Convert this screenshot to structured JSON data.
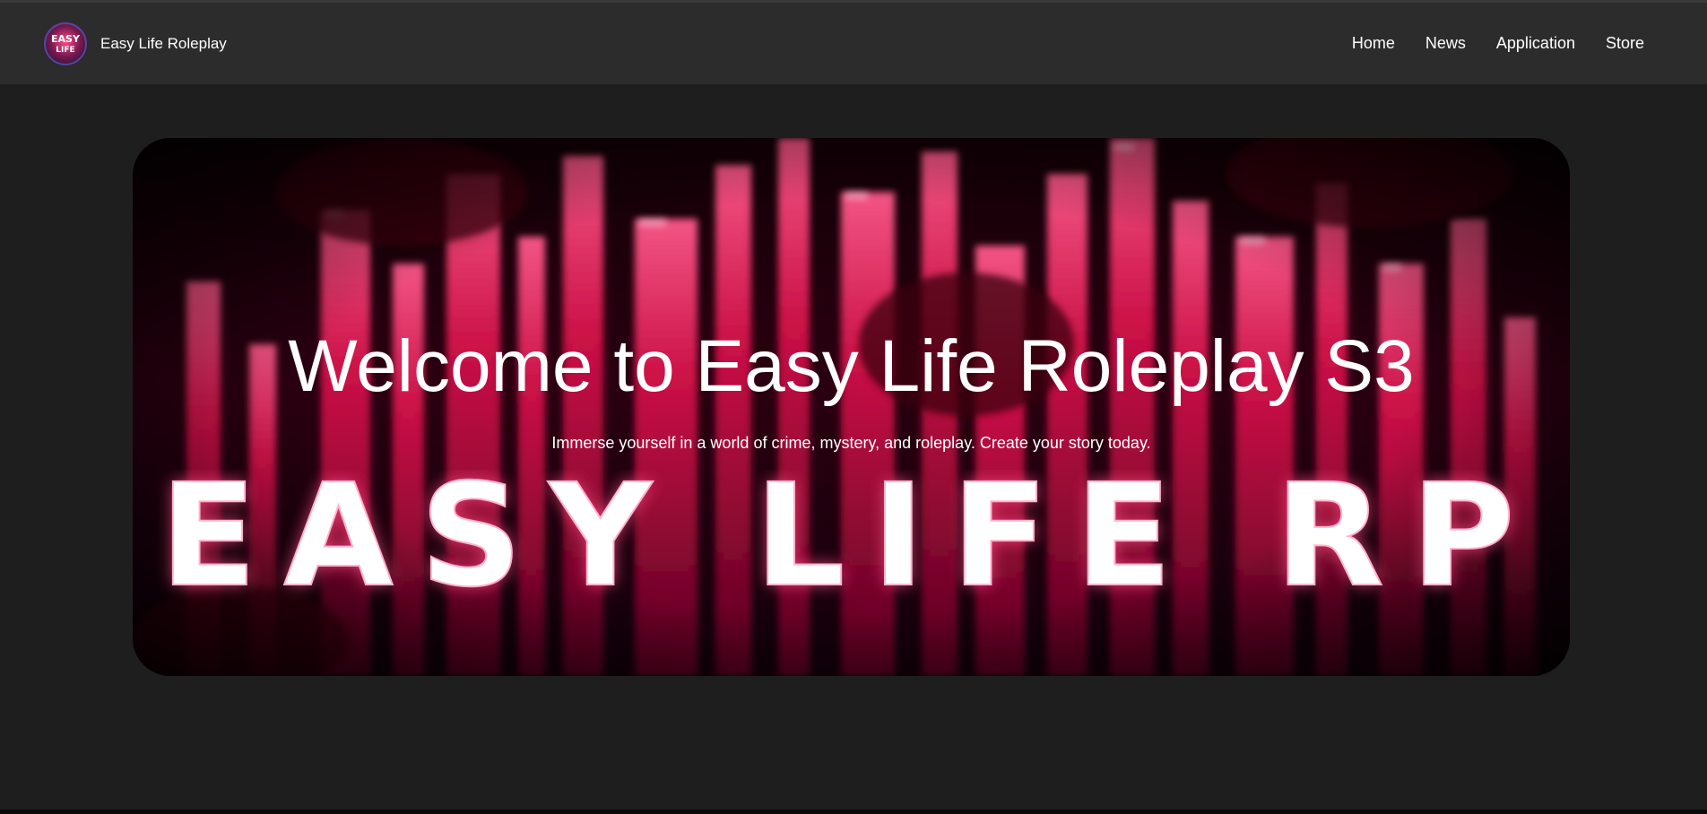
{
  "navbar": {
    "brand_name": "Easy Life Roleplay",
    "logo_text_top": "EASY",
    "logo_text_bottom": "LIFE",
    "links": [
      {
        "label": "Home"
      },
      {
        "label": "News"
      },
      {
        "label": "Application"
      },
      {
        "label": "Store"
      }
    ]
  },
  "hero": {
    "title": "Welcome to Easy Life Roleplay S3",
    "subtitle": "Immerse yourself in a world of crime, mystery, and roleplay. Create your story today.",
    "banner_text": "EASY LIFE RP"
  },
  "colors": {
    "page_background": "#1e1e1e",
    "navbar_background": "#2c2c2c",
    "accent": "#e0144e",
    "text": "#ffffff"
  }
}
